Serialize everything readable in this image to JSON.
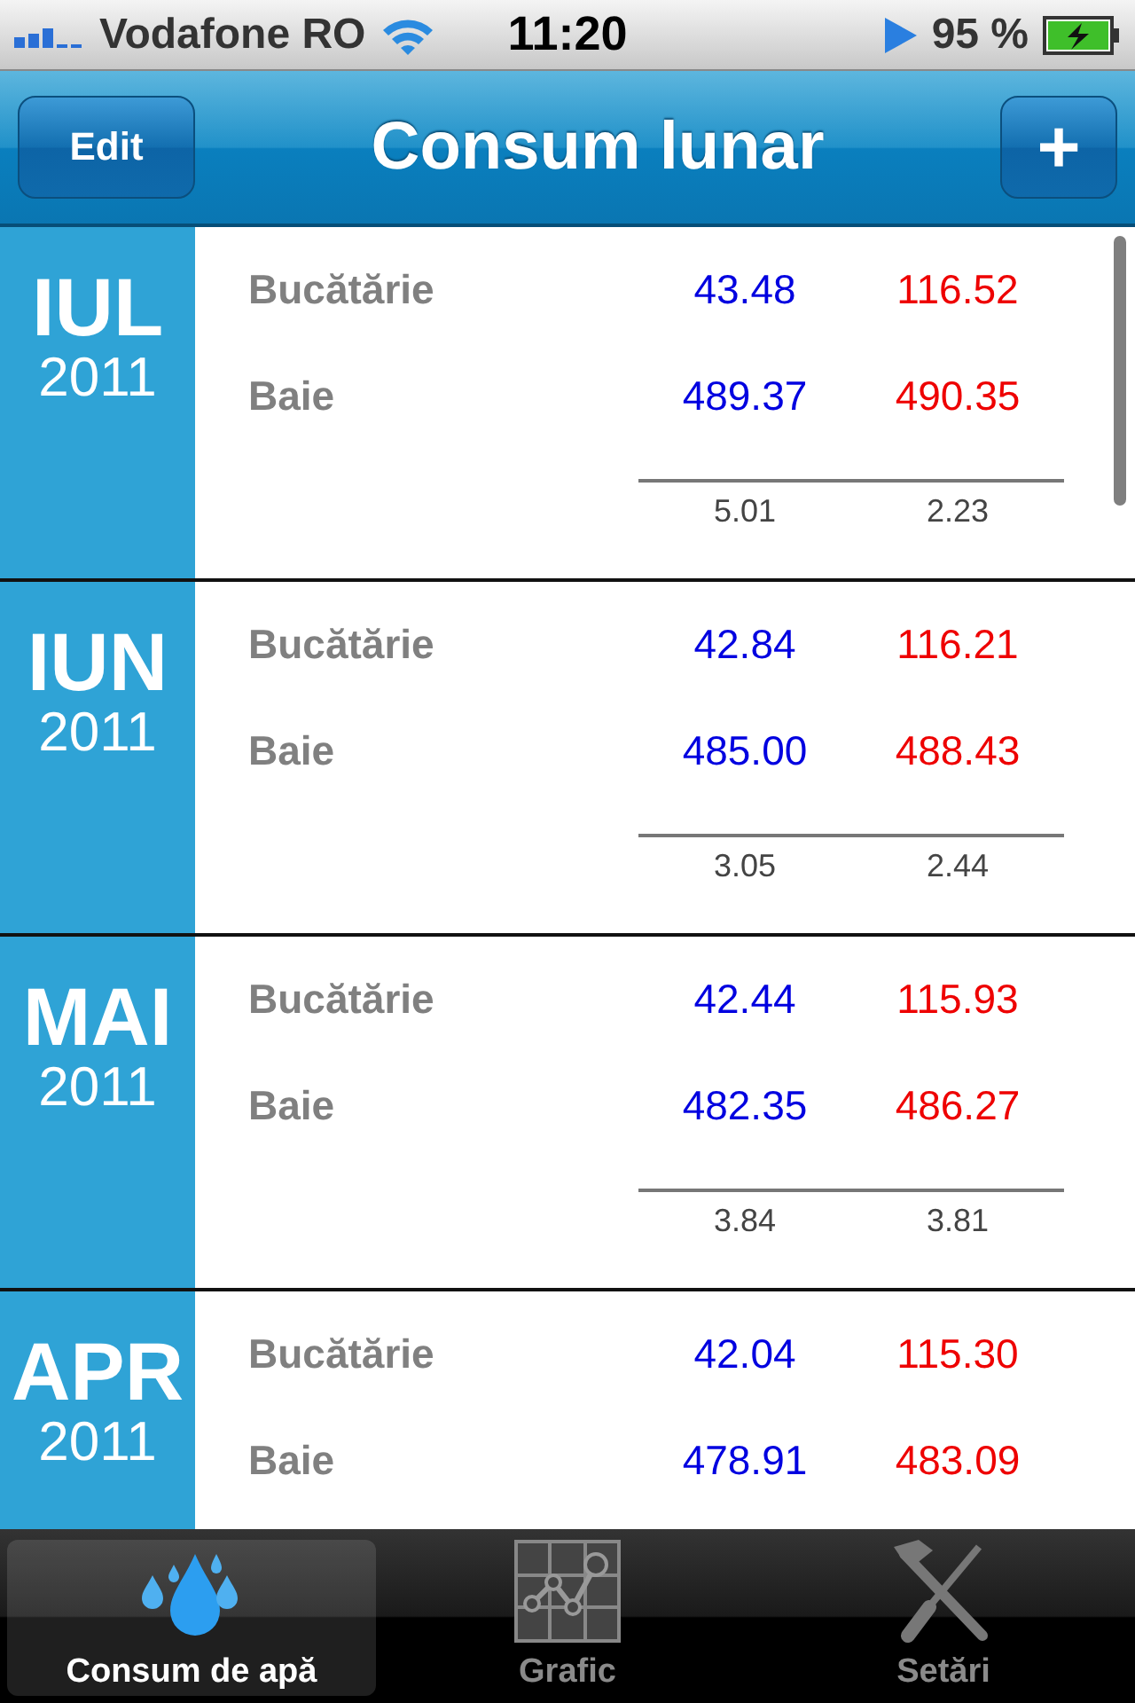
{
  "status_bar": {
    "carrier": "Vodafone RO",
    "time": "11:20",
    "battery": "95 %"
  },
  "nav": {
    "title": "Consum lunar",
    "edit": "Edit",
    "add": "+"
  },
  "months": [
    {
      "month": "IUL",
      "year": "2011",
      "rows": [
        {
          "label": "Bucătărie",
          "cold": "43.48",
          "hot": "116.52"
        },
        {
          "label": "Baie",
          "cold": "489.37",
          "hot": "490.35"
        }
      ],
      "totals": {
        "cold": "5.01",
        "hot": "2.23"
      }
    },
    {
      "month": "IUN",
      "year": "2011",
      "rows": [
        {
          "label": "Bucătărie",
          "cold": "42.84",
          "hot": "116.21"
        },
        {
          "label": "Baie",
          "cold": "485.00",
          "hot": "488.43"
        }
      ],
      "totals": {
        "cold": "3.05",
        "hot": "2.44"
      }
    },
    {
      "month": "MAI",
      "year": "2011",
      "rows": [
        {
          "label": "Bucătărie",
          "cold": "42.44",
          "hot": "115.93"
        },
        {
          "label": "Baie",
          "cold": "482.35",
          "hot": "486.27"
        }
      ],
      "totals": {
        "cold": "3.84",
        "hot": "3.81"
      }
    },
    {
      "month": "APR",
      "year": "2011",
      "rows": [
        {
          "label": "Bucătărie",
          "cold": "42.04",
          "hot": "115.30"
        },
        {
          "label": "Baie",
          "cold": "478.91",
          "hot": "483.09"
        }
      ]
    }
  ],
  "tabs": [
    {
      "label": "Consum de apă",
      "kind": "drops",
      "selected": true
    },
    {
      "label": "Grafic",
      "kind": "chart",
      "selected": false
    },
    {
      "label": "Setări",
      "kind": "tools",
      "selected": false
    }
  ]
}
